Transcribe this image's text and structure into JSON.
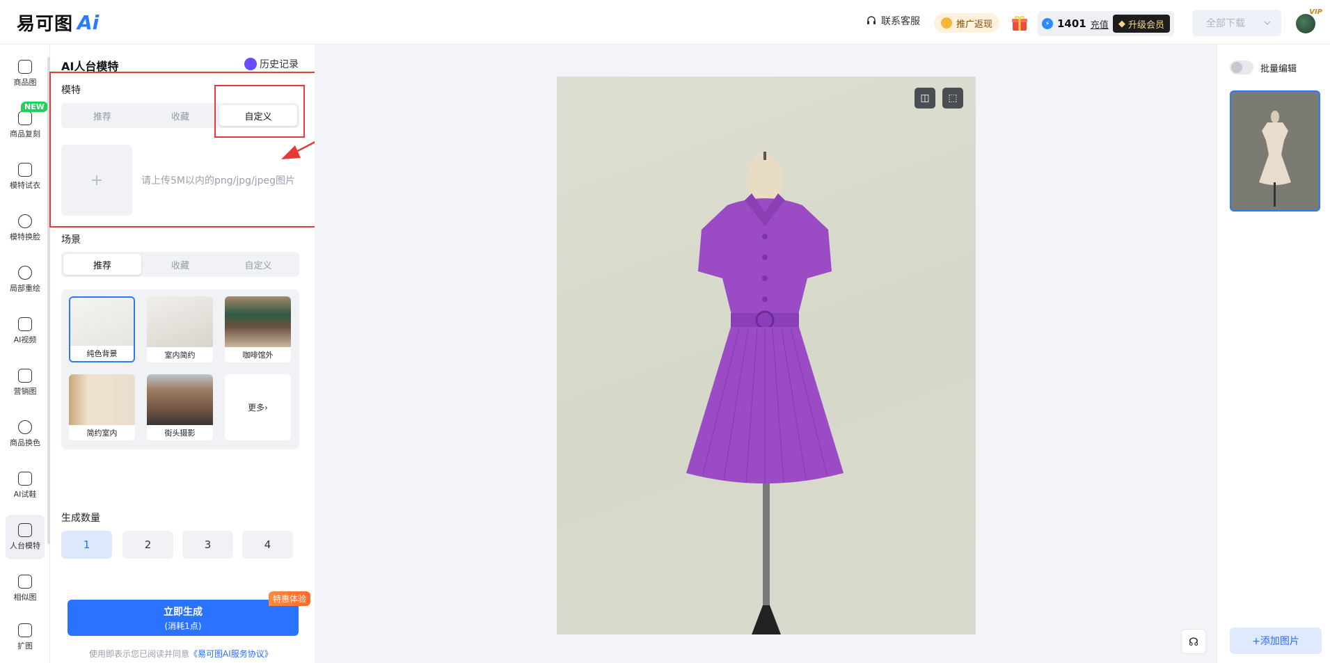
{
  "topbar": {
    "logo_text": "易可图",
    "logo_ai": "Ai",
    "customer_service": "联系客服",
    "promo": "推广返现",
    "credits": "1401",
    "recharge": "充值",
    "upgrade": "升级会员",
    "download_all": "全部下载",
    "vip_badge": "VIP"
  },
  "nav": [
    {
      "label": "商品图",
      "icon": "shopping-bag-icon"
    },
    {
      "label": "商品复刻",
      "icon": "copy-bag-icon"
    },
    {
      "label": "模特试衣",
      "icon": "shirt-icon"
    },
    {
      "label": "模特换脸",
      "icon": "face-icon"
    },
    {
      "label": "局部重绘",
      "icon": "face-edit-icon"
    },
    {
      "label": "AI视频",
      "icon": "video-icon"
    },
    {
      "label": "营销图",
      "icon": "poster-icon"
    },
    {
      "label": "商品换色",
      "icon": "drop-icon"
    },
    {
      "label": "AI试鞋",
      "icon": "shoe-icon"
    },
    {
      "label": "人台模特",
      "icon": "mannequin-icon"
    },
    {
      "label": "相似图",
      "icon": "similar-image-icon"
    },
    {
      "label": "扩图",
      "icon": "expand-ai-icon"
    }
  ],
  "nav_new_badge": "NEW",
  "panel": {
    "title": "AI人台模特",
    "history": "历史记录",
    "model_label": "模特",
    "model_tabs": [
      "推荐",
      "收藏",
      "自定义"
    ],
    "upload_plus": "+",
    "upload_hint": "请上传5M以内的png/jpg/jpeg图片",
    "scene_label": "场景",
    "scene_tabs": [
      "推荐",
      "收藏",
      "自定义"
    ],
    "scenes": [
      "纯色背景",
      "室内简约",
      "咖啡馆外",
      "简约室内",
      "街头摄影"
    ],
    "scene_more": "更多",
    "count_label": "生成数量",
    "counts": [
      "1",
      "2",
      "3",
      "4"
    ],
    "generate": "立即生成",
    "generate_cost": "(消耗1点)",
    "generate_badge": "特惠体验",
    "agree_prefix": "使用即表示您已阅读并同意",
    "agree_link": "《易可图AI服务协议》"
  },
  "right": {
    "batch_edit": "批量编辑",
    "add_image": "+添加图片"
  },
  "colors": {
    "accent": "#2a73ff",
    "annotation": "#e63a3a",
    "dress": "#9b4bc4"
  }
}
